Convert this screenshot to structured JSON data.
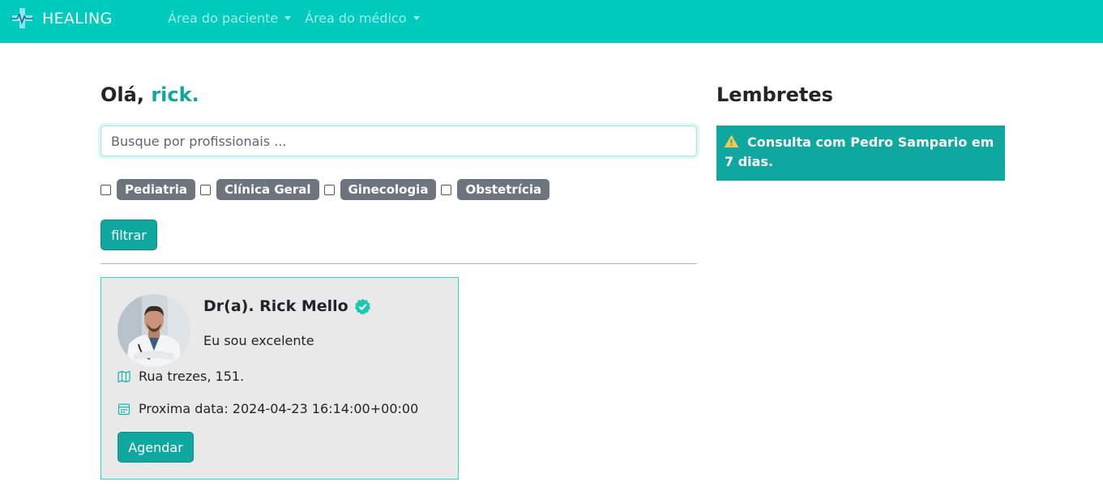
{
  "navbar": {
    "brand": "HEALING",
    "menus": [
      {
        "label": "Área do paciente"
      },
      {
        "label": "Área do médico"
      }
    ],
    "bg_color": "#00cbbd"
  },
  "main": {
    "greeting_prefix": "Olá,",
    "user_name": "rick.",
    "search_placeholder": "Busque por profissionais ...",
    "filters": [
      {
        "label": "Pediatria",
        "checked": false
      },
      {
        "label": "Clínica Geral",
        "checked": false
      },
      {
        "label": "Ginecologia",
        "checked": false
      },
      {
        "label": "Obstetrícia",
        "checked": false
      }
    ],
    "filter_button": "filtrar"
  },
  "doctor_card": {
    "name": "Dr(a). Rick Mello",
    "verified": true,
    "bio": "Eu sou excelente",
    "address": "Rua trezes, 151.",
    "next_date": "Proxima data: 2024-04-23 16:14:00+00:00",
    "schedule_button": "Agendar",
    "icons": {
      "address": "map-icon",
      "date": "calendar-icon",
      "verified": "verified-badge-icon"
    }
  },
  "reminders": {
    "title": "Lembretes",
    "items": [
      {
        "text": "Consulta com Pedro Sampario em 7 dias.",
        "icon": "warning-icon"
      }
    ]
  },
  "colors": {
    "primary": "#00cbbd",
    "button": "#0fa8a0",
    "badge": "#6c757d",
    "warning": "#f2c94c"
  }
}
